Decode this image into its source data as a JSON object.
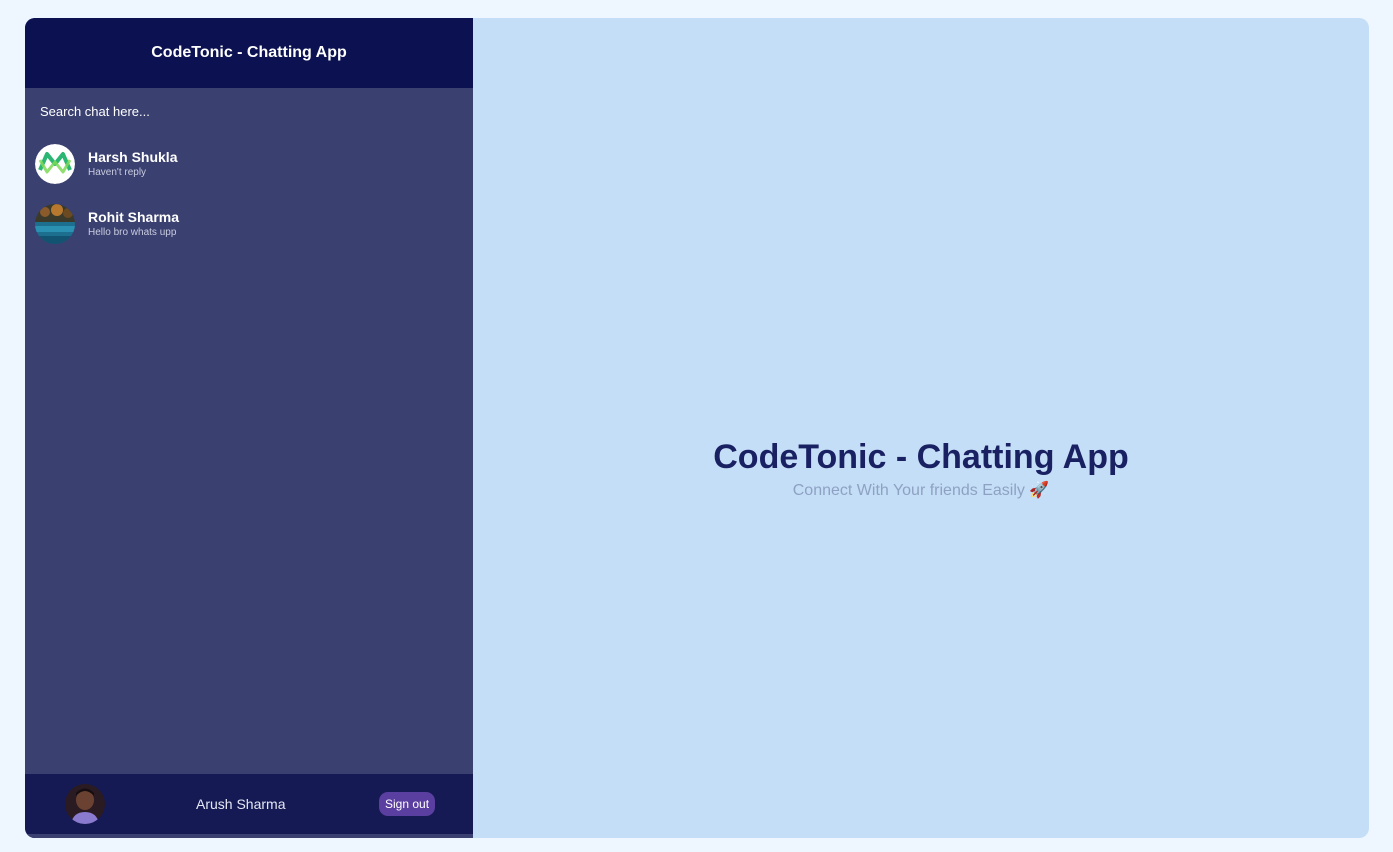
{
  "sidebar": {
    "title": "CodeTonic - Chatting App",
    "search_placeholder": "Search chat here...",
    "chats": [
      {
        "name": "Harsh Shukla",
        "last_message": "Haven't reply",
        "avatar_icon": "green-m-logo-icon"
      },
      {
        "name": "Rohit Sharma",
        "last_message": "Hello bro whats upp",
        "avatar_icon": "landscape-photo-avatar"
      }
    ]
  },
  "footer": {
    "user_name": "Arush Sharma",
    "signout_label": "Sign out"
  },
  "main": {
    "title": "CodeTonic - Chatting App",
    "subtitle": "Connect With Your friends Easily 🚀"
  },
  "colors": {
    "sidebar_header_bg": "#0c1251",
    "sidebar_bg": "#3a4070",
    "main_bg": "#c4def7",
    "signout_bg": "#5b3fa0",
    "title_color": "#1a2163"
  }
}
